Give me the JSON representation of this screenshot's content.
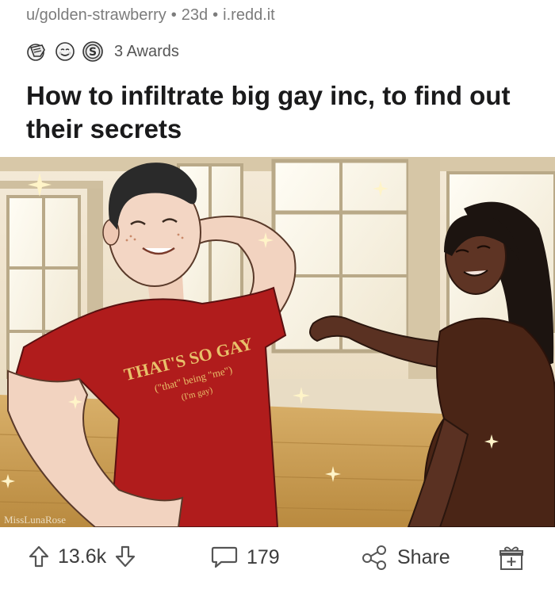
{
  "post": {
    "author": "u/golden-strawberry",
    "age": "23d",
    "domain": "i.redd.it",
    "separator": "•",
    "awards_label": "3 Awards",
    "awards": [
      "facepalm-award-icon",
      "wholesome-award-icon",
      "silver-coin-award-icon"
    ],
    "title": "How to infiltrate big gay inc, to find out their secrets"
  },
  "image": {
    "shirt_line1": "THAT'S SO GAY",
    "shirt_line2": "(\"that\" being \"me\")",
    "shirt_line3": "(I'm gay)",
    "watermark": "MissLunaRose"
  },
  "actions": {
    "upvotes": "13.6k",
    "comments": "179",
    "share_label": "Share"
  },
  "colors": {
    "shirt": "#b01c1c",
    "dress": "#4a2516",
    "floor": "#c49a52",
    "meta_text": "#7c7c7c"
  }
}
